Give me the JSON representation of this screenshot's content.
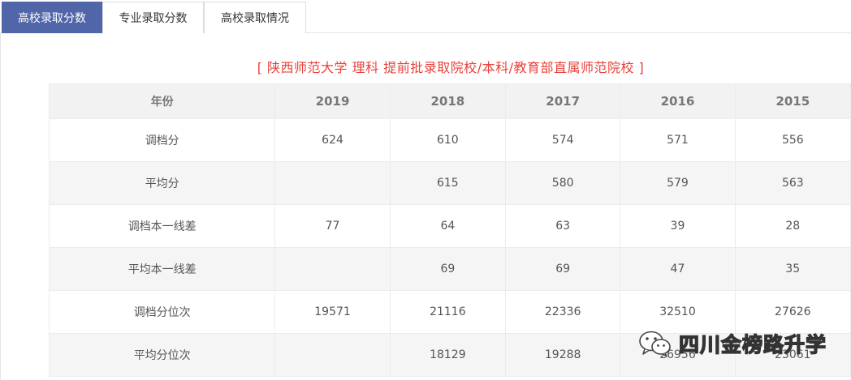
{
  "tabs": [
    {
      "label": "高校录取分数",
      "active": true
    },
    {
      "label": "专业录取分数",
      "active": false
    },
    {
      "label": "高校录取情况",
      "active": false
    }
  ],
  "caption": "[ 陕西师范大学  理科  提前批录取院校/本科/教育部直属师范院校 ]",
  "table": {
    "header": [
      "年份",
      "2019",
      "2018",
      "2017",
      "2016",
      "2015"
    ],
    "rows": [
      [
        "调档分",
        "624",
        "610",
        "574",
        "571",
        "556"
      ],
      [
        "平均分",
        "",
        "615",
        "580",
        "579",
        "563"
      ],
      [
        "调档本一线差",
        "77",
        "64",
        "63",
        "39",
        "28"
      ],
      [
        "平均本一线差",
        "",
        "69",
        "69",
        "47",
        "35"
      ],
      [
        "调档分位次",
        "19571",
        "21116",
        "22336",
        "32510",
        "27626"
      ],
      [
        "平均分位次",
        "",
        "18129",
        "19288",
        "26956",
        "23061"
      ]
    ]
  },
  "watermark": {
    "text": "四川金榜路升学",
    "icon": "wechat-icon"
  },
  "colors": {
    "tab_active": "#5166a9",
    "caption": "#e8413b",
    "header_bg": "#f2f2f2",
    "stripe_bg": "#f5f5f5"
  }
}
